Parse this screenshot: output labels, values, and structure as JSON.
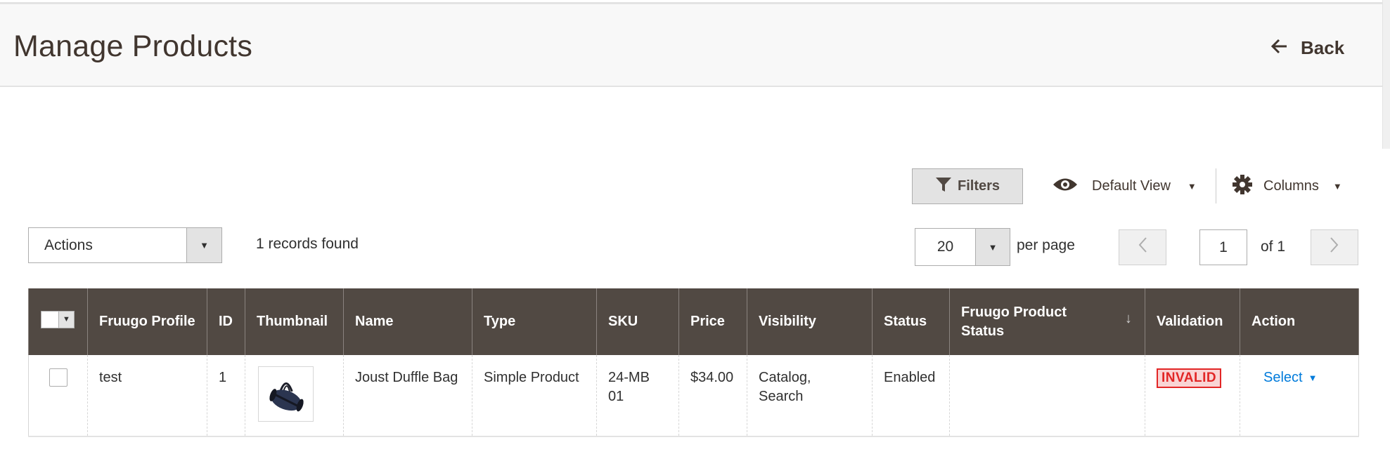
{
  "header": {
    "title": "Manage Products",
    "back_label": "Back"
  },
  "toolbar": {
    "filters_label": "Filters",
    "view_label": "Default View",
    "columns_label": "Columns",
    "actions_label": "Actions",
    "records_found": "1 records found",
    "per_page_value": "20",
    "per_page_label": "per page",
    "current_page": "1",
    "page_of": "of 1"
  },
  "icons": {
    "back": "arrow-left-icon",
    "filters": "funnel-icon",
    "view": "eye-icon",
    "columns": "gear-icon",
    "caret": "caret-down-icon",
    "prev": "chevron-left-icon",
    "next": "chevron-right-icon",
    "sort": "sort-down-icon"
  },
  "colors": {
    "header_bg": "#514943",
    "link": "#007bdb",
    "invalid_text": "#e22626",
    "invalid_bg": "#f9d4d4"
  },
  "table": {
    "columns": [
      "",
      "Fruugo Profile",
      "ID",
      "Thumbnail",
      "Name",
      "Type",
      "SKU",
      "Price",
      "Visibility",
      "Status",
      "Fruugo Product Status",
      "Validation",
      "Action"
    ],
    "sort_indicator": "↓",
    "rows": [
      {
        "profile": "test",
        "id": "1",
        "thumbnail": "Joust Duffle Bag image",
        "name": "Joust Duffle Bag",
        "type": "Simple Product",
        "sku": "24-MB01",
        "price": "$34.00",
        "visibility": "Catalog, Search",
        "status": "Enabled",
        "fruugo_status": "",
        "validation": "INVALID",
        "action": "Select"
      }
    ]
  }
}
